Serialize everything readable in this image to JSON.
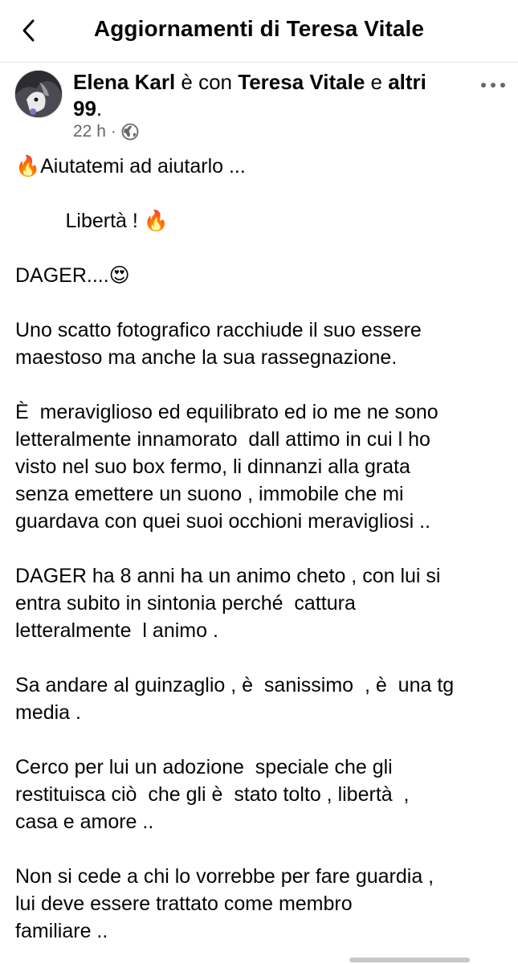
{
  "header": {
    "title": "Aggiornamenti di Teresa Vitale",
    "back_icon": "chevron-left-icon"
  },
  "post": {
    "author": "Elena Karl",
    "with_text": "è con",
    "tagged": "Teresa Vitale",
    "and_text": "e",
    "others": "altri 99",
    "period": ".",
    "time": "22 h",
    "dot": "·",
    "privacy_icon": "globe-icon",
    "more_icon": "more-horizontal-icon",
    "lines": [
      "🔥Aiutatemi ad aiutarlo ...",
      "",
      "         Libertà ! 🔥",
      "",
      "DAGER....😍",
      "",
      "Uno scatto fotografico racchiude il suo essere",
      "maestoso ma anche la sua rassegnazione.",
      "",
      "È  meraviglioso ed equilibrato ed io me ne sono",
      "letteralmente innamorato  dall attimo in cui l ho",
      "visto nel suo box fermo, li dinnanzi alla grata",
      "senza emettere un suono , immobile che mi",
      "guardava con quei suoi occhioni meravigliosi ..",
      "",
      "DAGER ha 8 anni ha un animo cheto , con lui si",
      "entra subito in sintonia perché  cattura",
      "letteralmente  l animo .",
      "",
      "Sa andare al guinzaglio , è  sanissimo  , è  una tg",
      "media .",
      "",
      "Cerco per lui un adozione  speciale che gli",
      "restituisca ciò  che gli è  stato tolto , libertà  ,",
      "casa e amore ..",
      "",
      "Non si cede a chi lo vorrebbe per fare guardia ,",
      "lui deve essere trattato come membro",
      "familiare .."
    ]
  },
  "colors": {
    "text": "#050505",
    "secondary": "#65676b",
    "divider": "#e4e6eb"
  }
}
